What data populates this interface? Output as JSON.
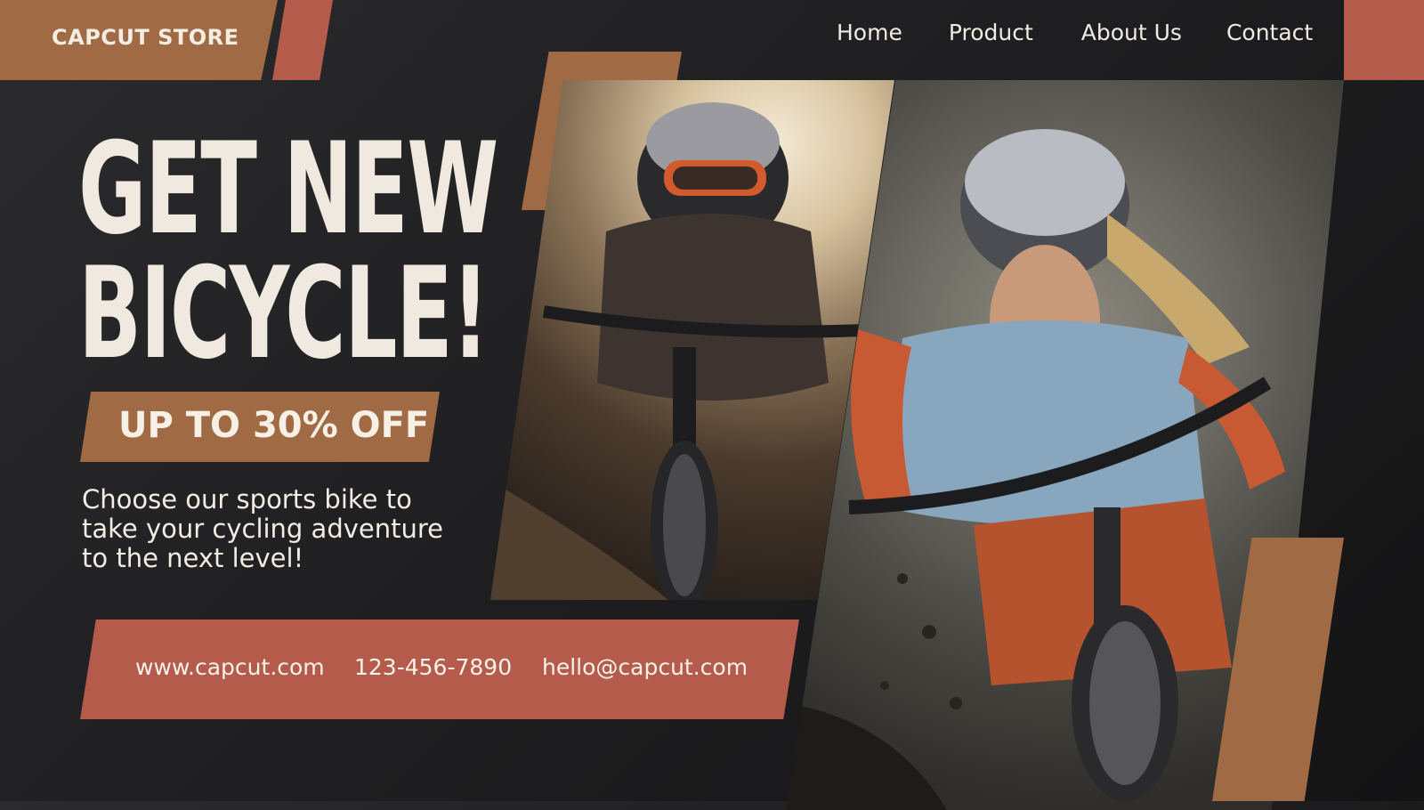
{
  "brand": {
    "name": "CAPCUT STORE"
  },
  "nav": {
    "items": [
      "Home",
      "Product",
      "About Us",
      "Contact"
    ]
  },
  "hero": {
    "line1": "GET NEW",
    "line2": "BICYCLE!",
    "badge": "UP TO 30% OFF",
    "description": "Choose our sports bike to take your cycling adventure to the next level!"
  },
  "contact": {
    "website": "www.capcut.com",
    "phone": "123-456-7890",
    "email": "hello@capcut.com"
  },
  "colors": {
    "background": "#1f1f21",
    "brown_accent": "#a06a44",
    "rust_accent": "#b45b4c",
    "text_light": "#efe9df"
  }
}
